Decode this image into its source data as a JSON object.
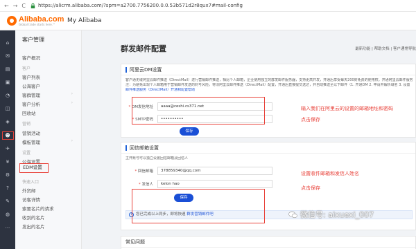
{
  "browser": {
    "url": "https://alicrm.alibaba.com/?spm=a2700.7756200.0.0.53b571d2r8qux7#mail-config",
    "nav_back": "←",
    "nav_forward": "→",
    "nav_reload": "C"
  },
  "header": {
    "logo_name": "Alibaba.com",
    "logo_tagline": "Global trade starts here.™",
    "app_title": "My Alibaba"
  },
  "menu": {
    "title": "客户管理",
    "items": [
      {
        "label": "客户概况"
      },
      {
        "group": "客户"
      },
      {
        "label": "客户列表"
      },
      {
        "label": "公海客户"
      },
      {
        "label": "客群管理"
      },
      {
        "label": "客户分析"
      },
      {
        "label": "回收站"
      },
      {
        "group": "营销"
      },
      {
        "label": "营销活动"
      },
      {
        "label": "模板管理"
      },
      {
        "group": "设置"
      },
      {
        "label": "公海设置"
      },
      {
        "label": "EDM设置"
      },
      {
        "group": "快速入口"
      },
      {
        "label": "外贸邮"
      },
      {
        "label": "访客详情"
      },
      {
        "label": "索要名片的请求"
      },
      {
        "label": "收到的名片"
      },
      {
        "label": "发出的名片"
      }
    ]
  },
  "main": {
    "page_title": "群发邮件配置",
    "top_links": "最新功能 | 帮助文档 | 客户通常导航",
    "dm_card": {
      "title": "阿里云DM设置",
      "desc_line1": "客户通无缝阿里云邮件推送（DirectMail）进行营销邮件推送，相比个人邮箱，企业使用独立的群发邮件服务器，支持更高并发，开通后享受每天200封免费的使用权。开通阿里云邮件服务",
      "desc_line2": "注：为避免出现个人邮箱用于营销邮件发送的封号风险，将须阿里云邮件推送（DirectMail）配置，开通后直接提交送达，并自动推送至以下邮件（1. 开通DM 2. 申请并解析域名 3. 设置",
      "desc_link": "邮件推送服务（DirectMail）开通和配置帮助",
      "field1_label": "DM发信地址",
      "field1_value": "aaaa@ceshi.cs371.net",
      "field2_label": "SMTP密码",
      "field2_value": "••••••••••",
      "save_label": "保存"
    },
    "reply_card": {
      "title": "回信邮箱设置",
      "hint": "主开账号可以独立设置回信邮箱及回信人",
      "field1_label": "回信邮箱",
      "field1_value": "378859340@qq.com",
      "field2_label": "发信人",
      "field2_value": "kelon hao",
      "save_label": "保存",
      "info_text": "您已完成以上同步，即将快速",
      "info_link": "群发营销邮件吧"
    },
    "faq_title": "常见问题"
  },
  "annotations": {
    "note1": "输入我们在阿里云的设置的邮箱地址和密码",
    "note2": "点击保存",
    "note3": "设置收件邮箱和发信人姓名",
    "note4": "点击保存"
  },
  "watermark": "微信号: aixuexi_007"
}
